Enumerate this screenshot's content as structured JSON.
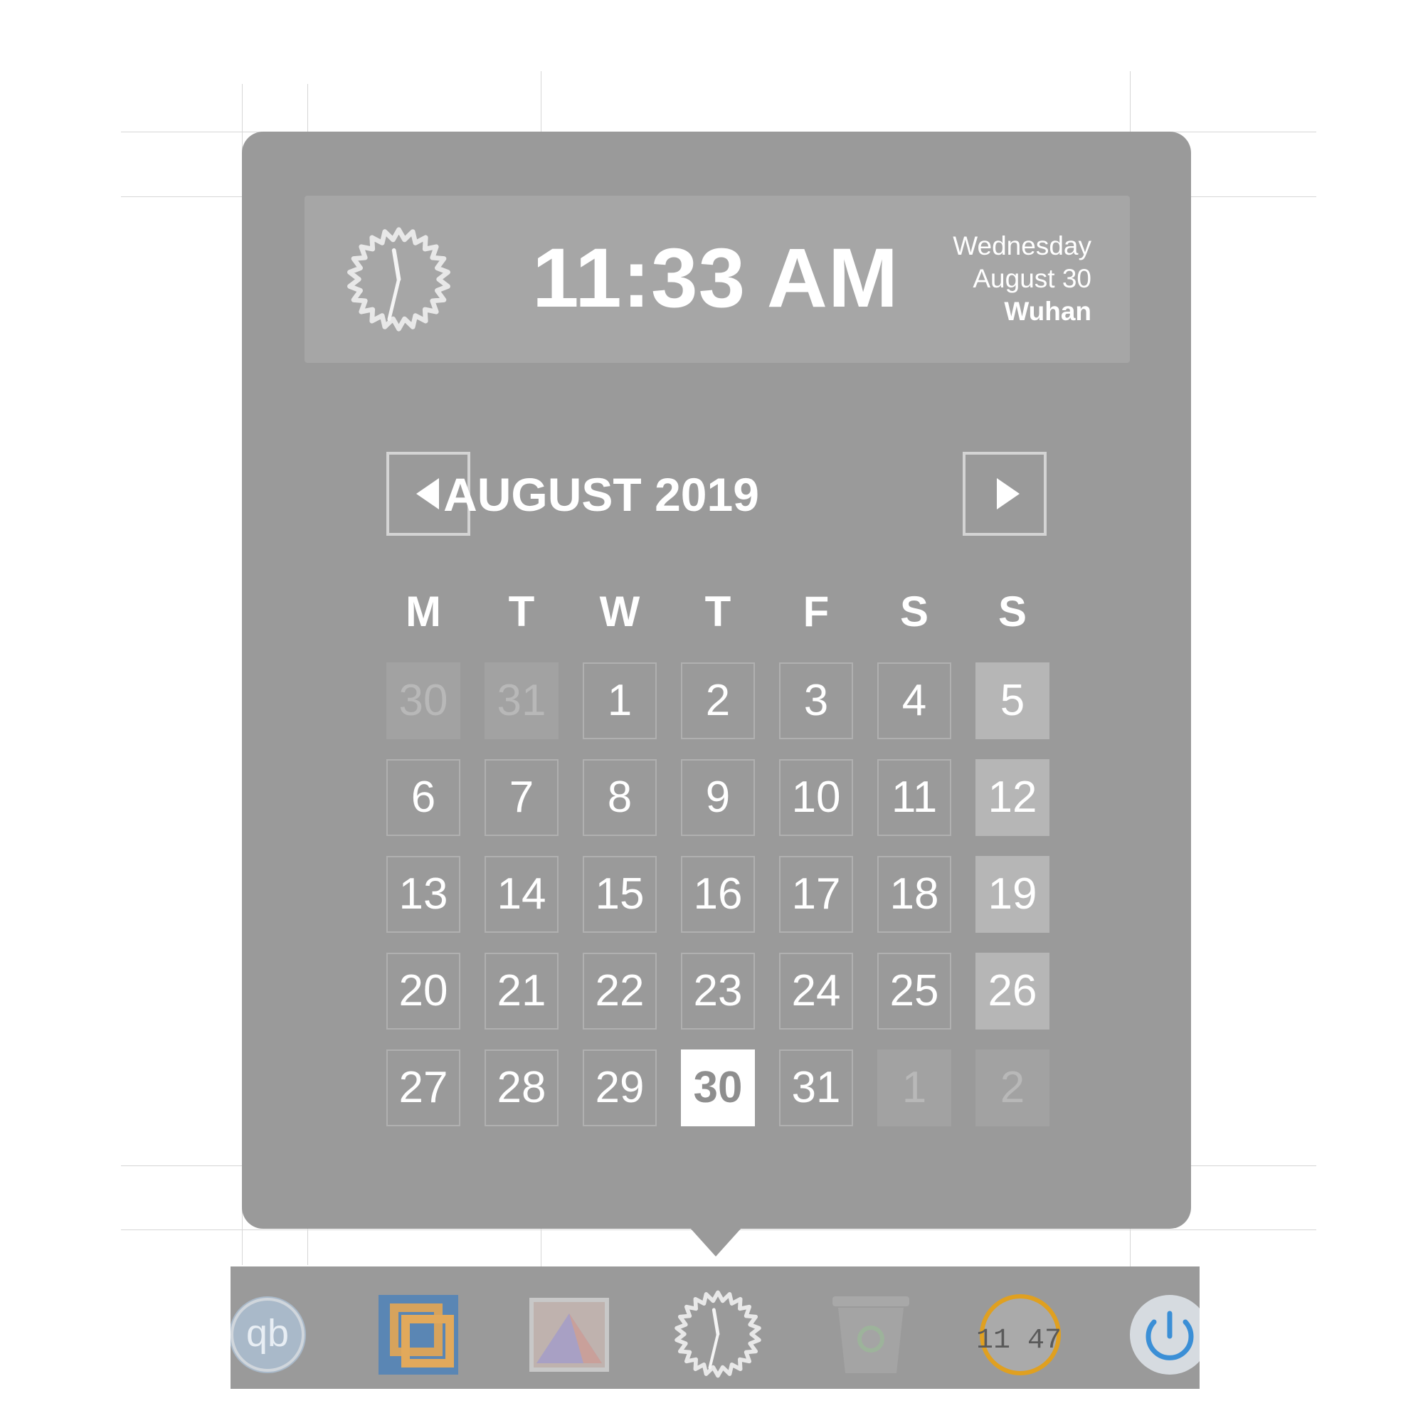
{
  "header": {
    "time": "11:33 AM",
    "weekday": "Wednesday",
    "date": "August 30",
    "city": "Wuhan"
  },
  "calendar": {
    "month_title": "AUGUST 2019",
    "weekdays": [
      "M",
      "T",
      "W",
      "T",
      "F",
      "S",
      "S"
    ],
    "weeks": [
      [
        "30",
        "31",
        "1",
        "2",
        "3",
        "4",
        "5"
      ],
      [
        "6",
        "7",
        "8",
        "9",
        "10",
        "11",
        "12"
      ],
      [
        "13",
        "14",
        "15",
        "16",
        "17",
        "18",
        "19"
      ],
      [
        "20",
        "21",
        "22",
        "23",
        "24",
        "25",
        "26"
      ],
      [
        "27",
        "28",
        "29",
        "30",
        "31",
        "1",
        "2"
      ]
    ],
    "today": "30"
  },
  "dock": {
    "items": [
      "qbittorrent-icon",
      "virtualbox-icon",
      "image-viewer-icon",
      "clock-icon",
      "trash-icon",
      "digital-clock-icon",
      "power-icon"
    ],
    "digital_clock_text": "11 47",
    "qb_text": "qb"
  },
  "colors": {
    "popup_bg": "#9a9a9a",
    "header_bg": "#a6a6a6",
    "weekend_bg": "#b6b6b6",
    "today_bg": "#ffffff",
    "power_blue": "#3b8fd6",
    "clock_ring": "#e0a020"
  }
}
